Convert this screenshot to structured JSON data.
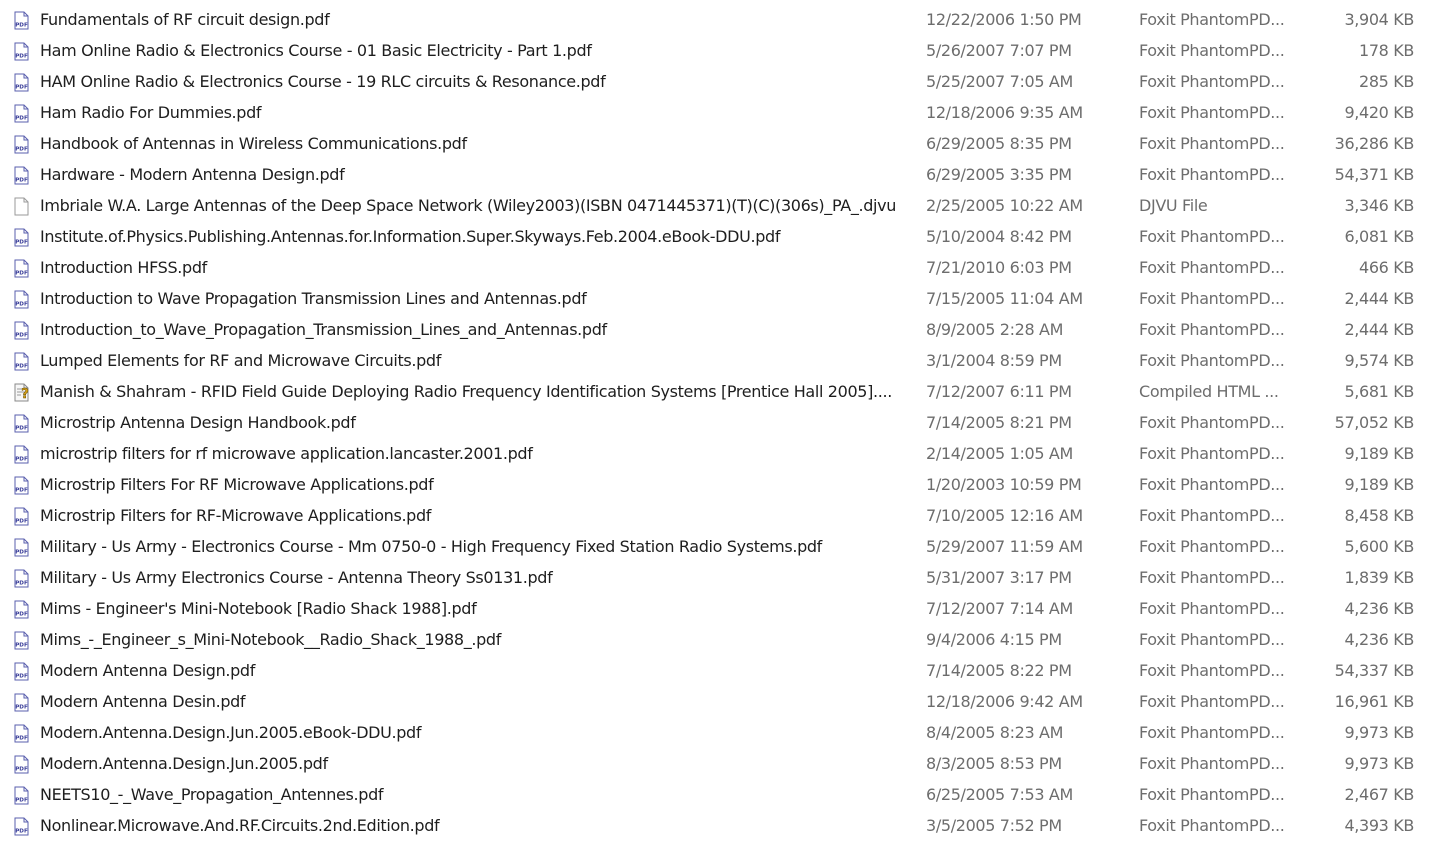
{
  "files": [
    {
      "name": "Fundamentals of RF circuit design.pdf",
      "date": "12/22/2006 1:50 PM",
      "type": "Foxit PhantomPD...",
      "size": "3,904 KB",
      "icon": "pdf-icon"
    },
    {
      "name": "Ham Online Radio & Electronics Course - 01 Basic Electricity - Part 1.pdf",
      "date": "5/26/2007 7:07 PM",
      "type": "Foxit PhantomPD...",
      "size": "178 KB",
      "icon": "pdf-icon"
    },
    {
      "name": "HAM Online Radio & Electronics Course - 19 RLC circuits & Resonance.pdf",
      "date": "5/25/2007 7:05 AM",
      "type": "Foxit PhantomPD...",
      "size": "285 KB",
      "icon": "pdf-icon"
    },
    {
      "name": "Ham Radio For Dummies.pdf",
      "date": "12/18/2006 9:35 AM",
      "type": "Foxit PhantomPD...",
      "size": "9,420 KB",
      "icon": "pdf-icon"
    },
    {
      "name": "Handbook of Antennas in Wireless Communications.pdf",
      "date": "6/29/2005 8:35 PM",
      "type": "Foxit PhantomPD...",
      "size": "36,286 KB",
      "icon": "pdf-icon"
    },
    {
      "name": "Hardware - Modern Antenna Design.pdf",
      "date": "6/29/2005 3:35 PM",
      "type": "Foxit PhantomPD...",
      "size": "54,371 KB",
      "icon": "pdf-icon"
    },
    {
      "name": "Imbriale W.A. Large Antennas of the Deep Space Network  (Wiley2003)(ISBN 0471445371)(T)(C)(306s)_PA_.djvu",
      "date": "2/25/2005 10:22 AM",
      "type": "DJVU File",
      "size": "3,346 KB",
      "icon": "blank-file-icon"
    },
    {
      "name": "Institute.of.Physics.Publishing.Antennas.for.Information.Super.Skyways.Feb.2004.eBook-DDU.pdf",
      "date": "5/10/2004 8:42 PM",
      "type": "Foxit PhantomPD...",
      "size": "6,081 KB",
      "icon": "pdf-icon"
    },
    {
      "name": "Introduction HFSS.pdf",
      "date": "7/21/2010 6:03 PM",
      "type": "Foxit PhantomPD...",
      "size": "466 KB",
      "icon": "pdf-icon"
    },
    {
      "name": "Introduction to Wave Propagation Transmission Lines and Antennas.pdf",
      "date": "7/15/2005 11:04 AM",
      "type": "Foxit PhantomPD...",
      "size": "2,444 KB",
      "icon": "pdf-icon"
    },
    {
      "name": "Introduction_to_Wave_Propagation_Transmission_Lines_and_Antennas.pdf",
      "date": "8/9/2005 2:28 AM",
      "type": "Foxit PhantomPD...",
      "size": "2,444 KB",
      "icon": "pdf-icon"
    },
    {
      "name": "Lumped Elements for RF and Microwave Circuits.pdf",
      "date": "3/1/2004 8:59 PM",
      "type": "Foxit PhantomPD...",
      "size": "9,574 KB",
      "icon": "pdf-icon"
    },
    {
      "name": "Manish & Shahram - RFID Field Guide Deploying Radio Frequency Identification Systems [Prentice Hall 2005]....",
      "date": "7/12/2007 6:11 PM",
      "type": "Compiled HTML ...",
      "size": "5,681 KB",
      "icon": "chm-help-icon"
    },
    {
      "name": "Microstrip Antenna Design Handbook.pdf",
      "date": "7/14/2005 8:21 PM",
      "type": "Foxit PhantomPD...",
      "size": "57,052 KB",
      "icon": "pdf-icon"
    },
    {
      "name": "microstrip filters for rf microwave application.lancaster.2001.pdf",
      "date": "2/14/2005 1:05 AM",
      "type": "Foxit PhantomPD...",
      "size": "9,189 KB",
      "icon": "pdf-icon"
    },
    {
      "name": "Microstrip Filters For RF Microwave Applications.pdf",
      "date": "1/20/2003 10:59 PM",
      "type": "Foxit PhantomPD...",
      "size": "9,189 KB",
      "icon": "pdf-icon"
    },
    {
      "name": "Microstrip Filters for RF-Microwave Applications.pdf",
      "date": "7/10/2005 12:16 AM",
      "type": "Foxit PhantomPD...",
      "size": "8,458 KB",
      "icon": "pdf-icon"
    },
    {
      "name": "Military - Us Army - Electronics Course - Mm 0750-0 - High Frequency Fixed Station Radio Systems.pdf",
      "date": "5/29/2007 11:59 AM",
      "type": "Foxit PhantomPD...",
      "size": "5,600 KB",
      "icon": "pdf-icon"
    },
    {
      "name": "Military - Us Army Electronics Course - Antenna Theory Ss0131.pdf",
      "date": "5/31/2007 3:17 PM",
      "type": "Foxit PhantomPD...",
      "size": "1,839 KB",
      "icon": "pdf-icon"
    },
    {
      "name": "Mims - Engineer's Mini-Notebook [Radio Shack 1988].pdf",
      "date": "7/12/2007 7:14 AM",
      "type": "Foxit PhantomPD...",
      "size": "4,236 KB",
      "icon": "pdf-icon"
    },
    {
      "name": "Mims_-_Engineer_s_Mini-Notebook__Radio_Shack_1988_.pdf",
      "date": "9/4/2006 4:15 PM",
      "type": "Foxit PhantomPD...",
      "size": "4,236 KB",
      "icon": "pdf-icon"
    },
    {
      "name": "Modern Antenna Design.pdf",
      "date": "7/14/2005 8:22 PM",
      "type": "Foxit PhantomPD...",
      "size": "54,337 KB",
      "icon": "pdf-icon"
    },
    {
      "name": "Modern Antenna Desin.pdf",
      "date": "12/18/2006 9:42 AM",
      "type": "Foxit PhantomPD...",
      "size": "16,961 KB",
      "icon": "pdf-icon"
    },
    {
      "name": "Modern.Antenna.Design.Jun.2005.eBook-DDU.pdf",
      "date": "8/4/2005 8:23 AM",
      "type": "Foxit PhantomPD...",
      "size": "9,973 KB",
      "icon": "pdf-icon"
    },
    {
      "name": "Modern.Antenna.Design.Jun.2005.pdf",
      "date": "8/3/2005 8:53 PM",
      "type": "Foxit PhantomPD...",
      "size": "9,973 KB",
      "icon": "pdf-icon"
    },
    {
      "name": "NEETS10_-_Wave_Propagation_Antennes.pdf",
      "date": "6/25/2005 7:53 AM",
      "type": "Foxit PhantomPD...",
      "size": "2,467 KB",
      "icon": "pdf-icon"
    },
    {
      "name": "Nonlinear.Microwave.And.RF.Circuits.2nd.Edition.pdf",
      "date": "3/5/2005 7:52 PM",
      "type": "Foxit PhantomPD...",
      "size": "4,393 KB",
      "icon": "pdf-icon"
    }
  ],
  "colors": {
    "pdf_icon_stroke": "#5a5fae",
    "pdf_icon_text": "#3b3f9a",
    "chm_icon_question": "#d4a017",
    "hover_row": "#e5f3ff",
    "secondary_text": "#6d6d6d"
  }
}
